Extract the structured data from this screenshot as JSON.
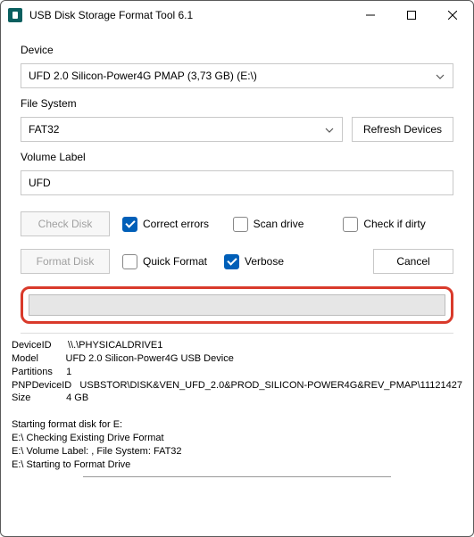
{
  "window": {
    "title": "USB Disk Storage Format Tool 6.1"
  },
  "labels": {
    "device": "Device",
    "filesystem": "File System",
    "volumelabel": "Volume Label"
  },
  "device": {
    "selected": "UFD 2.0  Silicon-Power4G  PMAP (3,73 GB) (E:\\)"
  },
  "filesystem": {
    "selected": "FAT32"
  },
  "buttons": {
    "refresh": "Refresh Devices",
    "checkdisk": "Check Disk",
    "formatdisk": "Format Disk",
    "cancel": "Cancel"
  },
  "volumelabel": {
    "value": "UFD"
  },
  "checks": {
    "correct": "Correct errors",
    "scan": "Scan drive",
    "dirty": "Check if dirty",
    "quick": "Quick Format",
    "verbose": "Verbose"
  },
  "log": {
    "l1": "DeviceID      \\\\.\\PHYSICALDRIVE1",
    "l2": "Model          UFD 2.0 Silicon-Power4G USB Device",
    "l3": "Partitions     1",
    "l4": "PNPDeviceID   USBSTOR\\DISK&VEN_UFD_2.0&PROD_SILICON-POWER4G&REV_PMAP\\11121427",
    "l5": "Size             4 GB",
    "l6": "",
    "l7": "Starting format disk for E:",
    "l8": "E:\\ Checking Existing Drive Format",
    "l9": "E:\\ Volume Label: , File System: FAT32",
    "l10": "E:\\ Starting to Format Drive"
  }
}
